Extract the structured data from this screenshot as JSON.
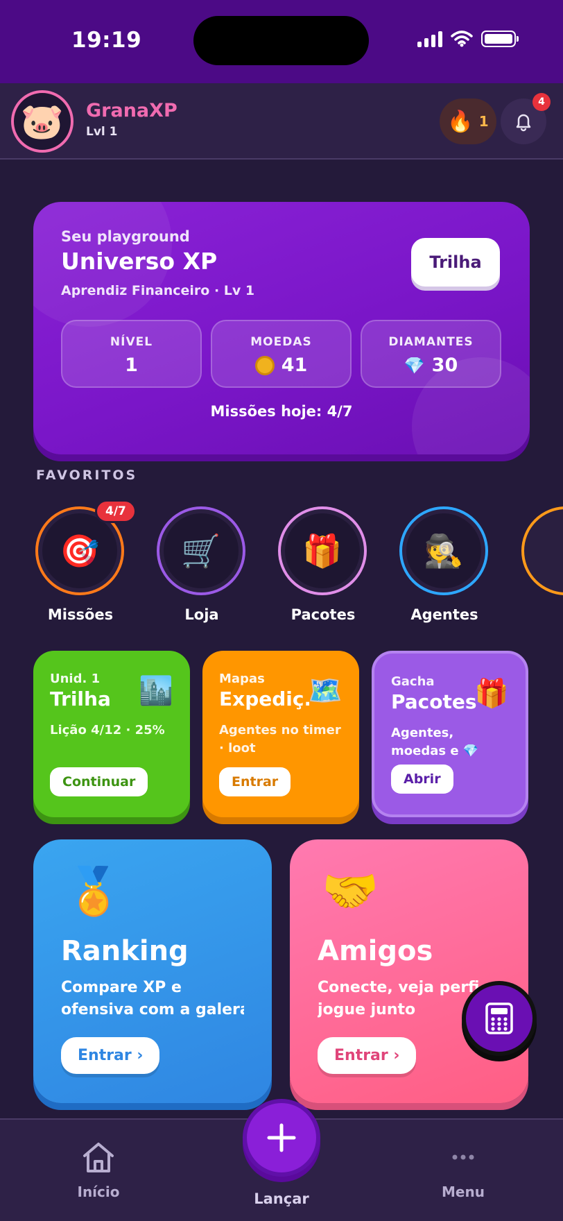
{
  "status_bar": {
    "time": "19:19"
  },
  "header": {
    "app_name": "GranaXP",
    "level": "Lvl 1",
    "streak_count": "1",
    "notifications_badge": "4"
  },
  "hero": {
    "eyebrow": "Seu playground",
    "title": "Universo XP",
    "subtitle": "Aprendiz Financeiro · Lv 1",
    "button": "Trilha",
    "stats": [
      {
        "label": "NÍVEL",
        "value": "1"
      },
      {
        "label": "MOEDAS",
        "value": "41"
      },
      {
        "label": "DIAMANTES",
        "value": "30"
      }
    ],
    "missions_today": "Missões hoje: 4/7"
  },
  "favorites": {
    "title": "FAVORITOS",
    "items": [
      {
        "label": "Missões",
        "badge": "4/7",
        "icon": "target-icon",
        "ring": "#ff7a1a"
      },
      {
        "label": "Loja",
        "icon": "cart-icon",
        "ring": "#9b5ae6"
      },
      {
        "label": "Pacotes",
        "icon": "gift-icon",
        "ring": "#e08ee8"
      },
      {
        "label": "Agentes",
        "icon": "detective-icon",
        "ring": "#2ea7ff"
      }
    ]
  },
  "cards": [
    {
      "eyebrow": "Unid. 1",
      "title": "Trilha",
      "desc": "Lição 4/12 · 25%",
      "button": "Continuar",
      "icon": "city-icon"
    },
    {
      "eyebrow": "Mapas",
      "title": "Expediç.",
      "desc": "Agentes no timer · loot",
      "button": "Entrar",
      "icon": "map-icon"
    },
    {
      "eyebrow": "Gacha",
      "title": "Pacotes",
      "desc": "Agentes, moedas e 💎",
      "button": "Abrir",
      "icon": "gift-icon"
    }
  ],
  "big_cards": [
    {
      "title": "Ranking",
      "desc_line1": "Compare XP e",
      "desc_line2": "ofensiva com a galera",
      "button": "Entrar ›",
      "icon": "medal-icon"
    },
    {
      "title": "Amigos",
      "desc_line1": "Conecte, veja perfi",
      "desc_line2": "jogue junto",
      "button": "Entrar ›",
      "icon": "handshake-icon"
    }
  ],
  "bottom_nav": {
    "home": "Início",
    "launch": "Lançar",
    "menu": "Menu"
  },
  "colors": {
    "accent_purple": "#7a16c8",
    "pink": "#f06bb0",
    "green": "#55c51c",
    "orange": "#ff9600",
    "blue": "#2f86e2"
  }
}
